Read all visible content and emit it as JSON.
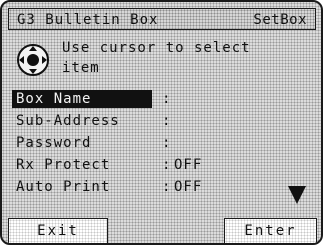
{
  "header": {
    "title": "G3 Bulletin Box",
    "mode": "SetBox"
  },
  "help": {
    "icon": "cursor-dial-icon",
    "line1": "Use cursor to select",
    "line2": "item"
  },
  "settings": [
    {
      "label": "Box Name",
      "sep": ":",
      "value": "",
      "selected": true
    },
    {
      "label": "Sub-Address",
      "sep": ":",
      "value": ""
    },
    {
      "label": "Password",
      "sep": ":",
      "value": ""
    },
    {
      "label": "Rx Protect",
      "sep": ":",
      "value": "OFF"
    },
    {
      "label": "Auto Print",
      "sep": ":",
      "value": "OFF"
    }
  ],
  "scroll_indicator": "down-arrow-icon",
  "softkeys": {
    "left": "Exit",
    "right": "Enter"
  },
  "colors": {
    "screen_bg": "#dcdcdc",
    "ink": "#111111",
    "selection": "#111111"
  }
}
